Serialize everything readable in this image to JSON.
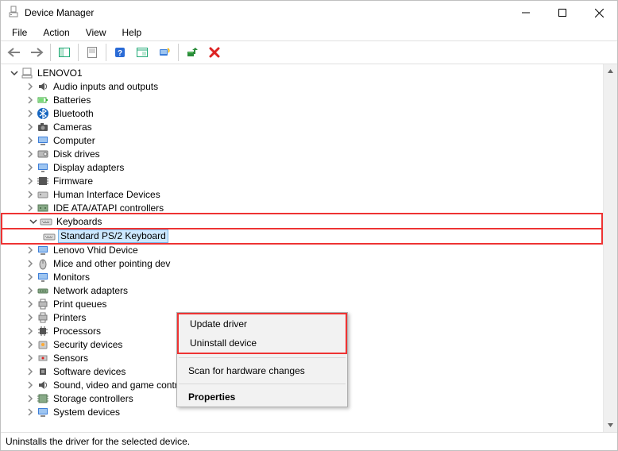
{
  "window": {
    "title": "Device Manager"
  },
  "menu": {
    "file": "File",
    "action": "Action",
    "view": "View",
    "help": "Help"
  },
  "tree": {
    "root": "LENOVO1",
    "items": [
      "Audio inputs and outputs",
      "Batteries",
      "Bluetooth",
      "Cameras",
      "Computer",
      "Disk drives",
      "Display adapters",
      "Firmware",
      "Human Interface Devices",
      "IDE ATA/ATAPI controllers",
      "Keyboards",
      "Lenovo Vhid Device",
      "Mice and other pointing dev",
      "Monitors",
      "Network adapters",
      "Print queues",
      "Printers",
      "Processors",
      "Security devices",
      "Sensors",
      "Software devices",
      "Sound, video and game controllers",
      "Storage controllers",
      "System devices"
    ],
    "keyboard_child": "Standard PS/2 Keyboard"
  },
  "context_menu": {
    "update": "Update driver",
    "uninstall": "Uninstall device",
    "scan": "Scan for hardware changes",
    "properties": "Properties"
  },
  "status": "Uninstalls the driver for the selected device."
}
